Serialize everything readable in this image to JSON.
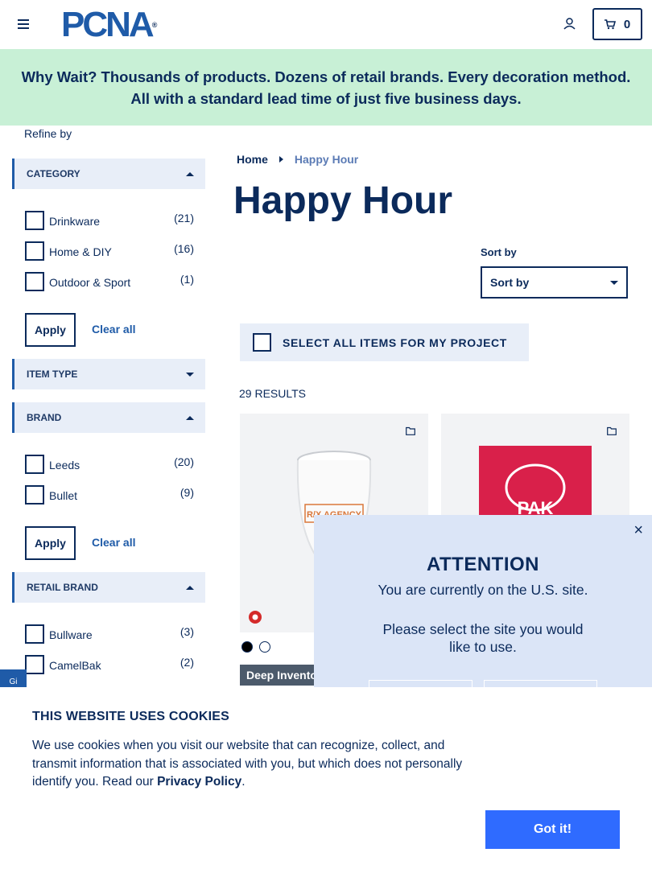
{
  "header": {
    "logo_text": "PCNA",
    "logo_mark": "®",
    "cart_count": "0"
  },
  "promo": {
    "text": "Why Wait? Thousands of products. Dozens of retail brands. Every decoration method. All with a standard lead time of just five business days."
  },
  "sidebar": {
    "refine_label": "Refine by",
    "category": {
      "title": "CATEGORY",
      "options": [
        {
          "label": "Drinkware",
          "count": "(21)"
        },
        {
          "label": "Home & DIY",
          "count": "(16)"
        },
        {
          "label": "Outdoor & Sport",
          "count": "(1)"
        }
      ],
      "apply_label": "Apply",
      "clear_label": "Clear all"
    },
    "item_type": {
      "title": "ITEM TYPE"
    },
    "brand": {
      "title": "BRAND",
      "options": [
        {
          "label": "Leeds",
          "count": "(20)"
        },
        {
          "label": "Bullet",
          "count": "(9)"
        }
      ],
      "apply_label": "Apply",
      "clear_label": "Clear all"
    },
    "retail_brand": {
      "title": "RETAIL BRAND",
      "options": [
        {
          "label": "Bullware",
          "count": "(3)"
        },
        {
          "label": "CamelBak",
          "count": "(2)"
        }
      ]
    },
    "side_tab_text": "Gi"
  },
  "main": {
    "breadcrumb": {
      "home": "Home",
      "current": "Happy Hour"
    },
    "title": "Happy Hour",
    "sort": {
      "label": "Sort by",
      "selected": "Sort by"
    },
    "select_all_label": "SELECT ALL ITEMS FOR MY PROJECT",
    "results_count": "29 RESULTS",
    "products": [
      {
        "mug_text": "R/X AGENCY",
        "badge": "Deep Invento"
      },
      {
        "mug_text": "PAK"
      }
    ],
    "swatch_colors": [
      "#000000",
      "#ffffff"
    ]
  },
  "modal": {
    "close": "×",
    "title": "ATTENTION",
    "line1": "You are currently on the U.S. site.",
    "line2": "Please select the site you would like to use."
  },
  "cookie": {
    "title": "THIS WEBSITE USES COOKIES",
    "message": "We use cookies when you visit our website that can recognize, collect, and transmit information that is associated with you, but which does not personally identify you. Read our ",
    "privacy_link": "Privacy Policy",
    "period": ".",
    "button": "Got it!"
  }
}
